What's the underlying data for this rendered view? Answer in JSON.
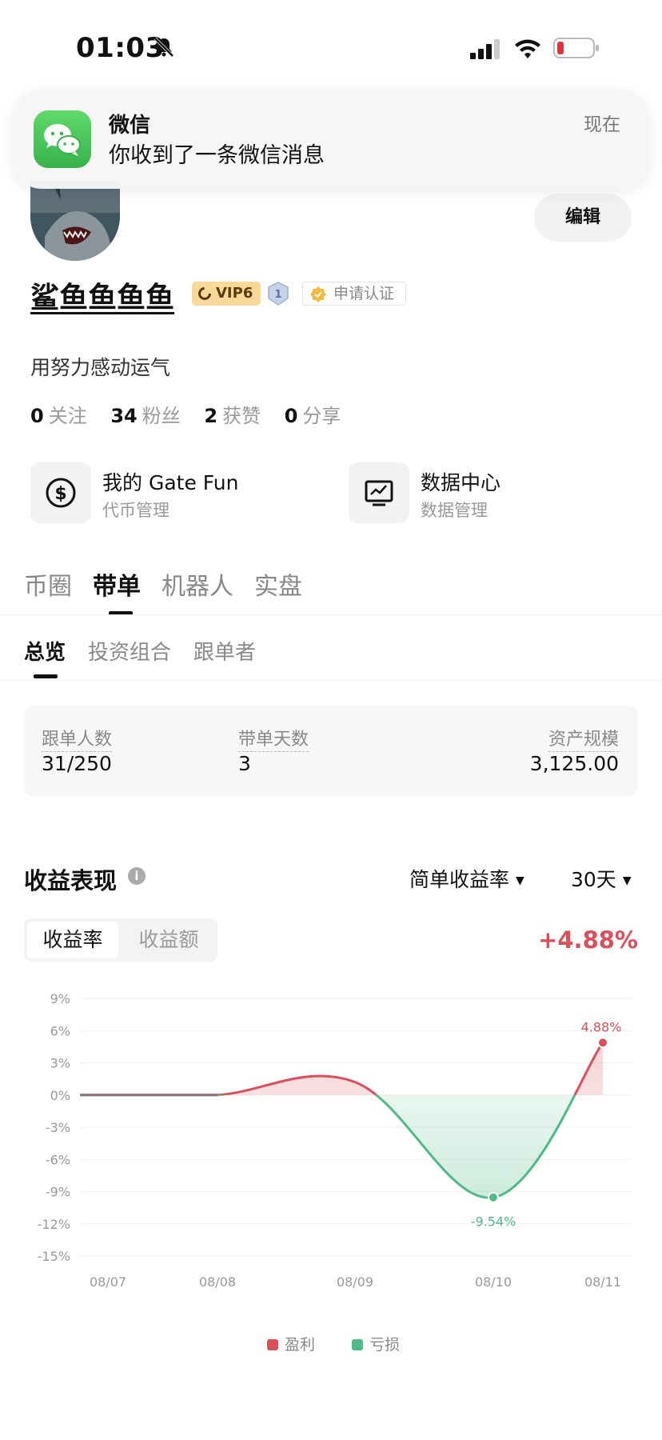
{
  "status_bar": {
    "time": "01:03"
  },
  "notification": {
    "app": "微信",
    "message": "你收到了一条微信消息",
    "time": "现在"
  },
  "profile": {
    "edit_label": "编辑",
    "username": "鲨鱼鱼鱼鱼",
    "vip": "VIP6",
    "level": "1",
    "certify": "申请认证",
    "bio": "用努力感动运气",
    "stats": [
      {
        "value": "0",
        "label": "关注"
      },
      {
        "value": "34",
        "label": "粉丝"
      },
      {
        "value": "2",
        "label": "获赞"
      },
      {
        "value": "0",
        "label": "分享"
      }
    ]
  },
  "features": [
    {
      "title": "我的 Gate Fun",
      "subtitle": "代币管理",
      "icon": "dollar-circle-icon"
    },
    {
      "title": "数据中心",
      "subtitle": "数据管理",
      "icon": "chart-board-icon"
    }
  ],
  "tabs": [
    "币圈",
    "带单",
    "机器人",
    "实盘"
  ],
  "subtabs": [
    "总览",
    "投资组合",
    "跟单者"
  ],
  "summary": [
    {
      "label": "跟单人数",
      "value": "31/250"
    },
    {
      "label": "带单天数",
      "value": "3"
    },
    {
      "label": "资产规模",
      "value": "3,125.00"
    }
  ],
  "performance": {
    "title": "收益表现",
    "metric_dropdown": "简单收益率",
    "period_dropdown": "30天",
    "toggle": [
      "收益率",
      "收益额"
    ],
    "headline": "+4.88%"
  },
  "chart_data": {
    "type": "line",
    "x": [
      "08/07",
      "08/08",
      "08/09",
      "08/10",
      "08/11"
    ],
    "y_ticks": [
      "9%",
      "6%",
      "3%",
      "0%",
      "-3%",
      "-6%",
      "-9%",
      "-12%",
      "-15%"
    ],
    "ylim": [
      -15,
      9
    ],
    "points": [
      {
        "x": "08/07",
        "y": 0
      },
      {
        "x": "08/08",
        "y": 0
      },
      {
        "x": "08/09",
        "y": 1.2
      },
      {
        "x": "08/10",
        "y": -9.54
      },
      {
        "x": "08/11",
        "y": 4.88
      }
    ],
    "annotations": [
      {
        "text": "4.88%",
        "x": "08/11",
        "y": 4.88
      },
      {
        "text": "-9.54%",
        "x": "08/10",
        "y": -9.54
      }
    ],
    "legend": [
      {
        "name": "盈利",
        "color": "#d9505b"
      },
      {
        "name": "亏损",
        "color": "#4fb987"
      }
    ],
    "grid": true
  }
}
